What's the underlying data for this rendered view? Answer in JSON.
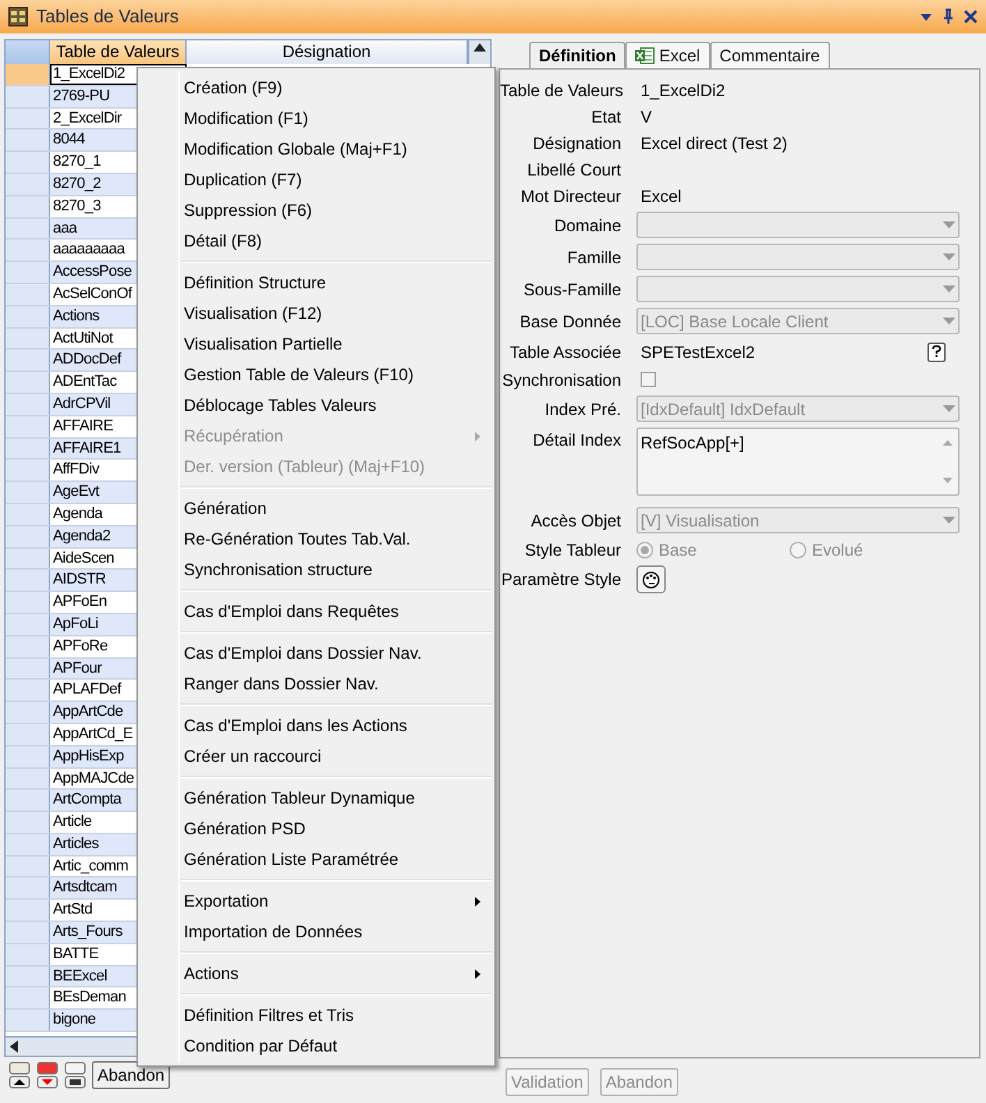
{
  "window": {
    "title": "Tables de Valeurs"
  },
  "grid": {
    "columns": [
      "Table de Valeurs",
      "Désignation"
    ],
    "rows": [
      {
        "value": "1_ExcelDi2",
        "selected": true
      },
      {
        "value": "2769-PU",
        "selected": false
      },
      {
        "value": "2_ExcelDir",
        "selected": false
      },
      {
        "value": "8044",
        "selected": false
      },
      {
        "value": "8270_1",
        "selected": false
      },
      {
        "value": "8270_2",
        "selected": false
      },
      {
        "value": "8270_3",
        "selected": false
      },
      {
        "value": "aaa",
        "selected": false
      },
      {
        "value": "aaaaaaaaa",
        "selected": false
      },
      {
        "value": "AccessPose",
        "selected": false
      },
      {
        "value": "AcSelConOf",
        "selected": false
      },
      {
        "value": "Actions",
        "selected": false
      },
      {
        "value": "ActUtiNot",
        "selected": false
      },
      {
        "value": "ADDocDef",
        "selected": false
      },
      {
        "value": "ADEntTac",
        "selected": false
      },
      {
        "value": "AdrCPVil",
        "selected": false
      },
      {
        "value": "AFFAIRE",
        "selected": false
      },
      {
        "value": "AFFAIRE1",
        "selected": false
      },
      {
        "value": "AffFDiv",
        "selected": false
      },
      {
        "value": "AgeEvt",
        "selected": false
      },
      {
        "value": "Agenda",
        "selected": false
      },
      {
        "value": "Agenda2",
        "selected": false
      },
      {
        "value": "AideScen",
        "selected": false
      },
      {
        "value": "AIDSTR",
        "selected": false
      },
      {
        "value": "APFoEn",
        "selected": false
      },
      {
        "value": "ApFoLi",
        "selected": false
      },
      {
        "value": "APFoRe",
        "selected": false
      },
      {
        "value": "APFour",
        "selected": false
      },
      {
        "value": "APLAFDef",
        "selected": false
      },
      {
        "value": "AppArtCde",
        "selected": false
      },
      {
        "value": "AppArtCd_E",
        "selected": false
      },
      {
        "value": "AppHisExp",
        "selected": false
      },
      {
        "value": "AppMAJCde",
        "selected": false
      },
      {
        "value": "ArtCompta",
        "selected": false
      },
      {
        "value": "Article",
        "selected": false
      },
      {
        "value": "Articles",
        "selected": false
      },
      {
        "value": "Artic_comm",
        "selected": false
      },
      {
        "value": "Artsdtcam",
        "selected": false
      },
      {
        "value": "ArtStd",
        "selected": false
      },
      {
        "value": "Arts_Fours",
        "selected": false
      },
      {
        "value": "BATTE",
        "selected": false
      },
      {
        "value": "BEExcel",
        "selected": false
      },
      {
        "value": "BEsDeman",
        "selected": false
      },
      {
        "value": "bigone",
        "selected": false
      }
    ]
  },
  "grid_footer": {
    "button": "Abandon"
  },
  "context_menu": {
    "groups": [
      [
        {
          "label": "Création (F9)",
          "disabled": false,
          "submenu": false
        },
        {
          "label": "Modification (F1)",
          "disabled": false,
          "submenu": false
        },
        {
          "label": "Modification Globale (Maj+F1)",
          "disabled": false,
          "submenu": false
        },
        {
          "label": "Duplication (F7)",
          "disabled": false,
          "submenu": false
        },
        {
          "label": "Suppression (F6)",
          "disabled": false,
          "submenu": false
        },
        {
          "label": "Détail (F8)",
          "disabled": false,
          "submenu": false
        }
      ],
      [
        {
          "label": "Définition Structure",
          "disabled": false,
          "submenu": false
        },
        {
          "label": "Visualisation (F12)",
          "disabled": false,
          "submenu": false
        },
        {
          "label": "Visualisation Partielle",
          "disabled": false,
          "submenu": false
        },
        {
          "label": "Gestion Table de Valeurs (F10)",
          "disabled": false,
          "submenu": false
        },
        {
          "label": "Déblocage Tables Valeurs",
          "disabled": false,
          "submenu": false
        },
        {
          "label": "Récupération",
          "disabled": true,
          "submenu": true
        },
        {
          "label": "Der. version (Tableur) (Maj+F10)",
          "disabled": true,
          "submenu": false
        }
      ],
      [
        {
          "label": "Génération",
          "disabled": false,
          "submenu": false
        },
        {
          "label": "Re-Génération Toutes Tab.Val.",
          "disabled": false,
          "submenu": false
        },
        {
          "label": "Synchronisation structure",
          "disabled": false,
          "submenu": false
        }
      ],
      [
        {
          "label": "Cas d'Emploi dans Requêtes",
          "disabled": false,
          "submenu": false
        }
      ],
      [
        {
          "label": "Cas d'Emploi dans Dossier Nav.",
          "disabled": false,
          "submenu": false
        },
        {
          "label": "Ranger dans Dossier Nav.",
          "disabled": false,
          "submenu": false
        }
      ],
      [
        {
          "label": "Cas d'Emploi dans les Actions",
          "disabled": false,
          "submenu": false
        },
        {
          "label": "Créer un raccourci",
          "disabled": false,
          "submenu": false
        }
      ],
      [
        {
          "label": "Génération Tableur Dynamique",
          "disabled": false,
          "submenu": false
        },
        {
          "label": "Génération PSD",
          "disabled": false,
          "submenu": false
        },
        {
          "label": "Génération Liste Paramétrée",
          "disabled": false,
          "submenu": false
        }
      ],
      [
        {
          "label": "Exportation",
          "disabled": false,
          "submenu": true
        },
        {
          "label": "Importation de Données",
          "disabled": false,
          "submenu": false
        }
      ],
      [
        {
          "label": "Actions",
          "disabled": false,
          "submenu": true
        }
      ],
      [
        {
          "label": "Définition Filtres et Tris",
          "disabled": false,
          "submenu": false
        },
        {
          "label": "Condition par Défaut",
          "disabled": false,
          "submenu": false
        }
      ]
    ]
  },
  "detail": {
    "tabs": [
      {
        "label": "Définition",
        "selected": true,
        "kind": "plain"
      },
      {
        "label": "Excel",
        "selected": false,
        "kind": "excel"
      },
      {
        "label": "Commentaire",
        "selected": false,
        "kind": "plain"
      }
    ],
    "fields": [
      {
        "kind": "text",
        "label": "Table de Valeurs",
        "value": "1_ExcelDi2"
      },
      {
        "kind": "text",
        "label": "Etat",
        "value": "V"
      },
      {
        "kind": "text",
        "label": "Désignation",
        "value": "Excel direct (Test 2)"
      },
      {
        "kind": "text",
        "label": "Libellé Court"
      },
      {
        "kind": "text",
        "label": "Mot Directeur",
        "value": "Excel"
      },
      {
        "kind": "combo",
        "label": "Domaine",
        "disabled": true
      },
      {
        "kind": "combo",
        "label": "Famille",
        "disabled": true
      },
      {
        "kind": "combo",
        "label": "Sous-Famille",
        "disabled": true
      },
      {
        "kind": "combo",
        "label": "Base Donnée",
        "value": "[LOC] Base Locale Client",
        "disabled": true
      },
      {
        "kind": "text_help",
        "label": "Table Associée",
        "value": "SPETestExcel2"
      },
      {
        "kind": "checkbox",
        "label": "Synchronisation",
        "checked": false
      },
      {
        "kind": "combo",
        "label": "Index Pré.",
        "value": "[IdxDefault] IdxDefault",
        "disabled": true
      },
      {
        "kind": "textarea",
        "label": "Détail Index",
        "value": "RefSocApp[+]"
      },
      {
        "kind": "combo",
        "label": "Accès Objet",
        "value": "[V] Visualisation",
        "disabled": true
      },
      {
        "kind": "radio",
        "label": "Style Tableur",
        "options": [
          {
            "label": "Base",
            "selected": true
          },
          {
            "label": "Evolué",
            "selected": false
          }
        ]
      },
      {
        "kind": "style_button",
        "label": "Paramètre Style"
      }
    ]
  },
  "footer_buttons": [
    {
      "label": "Validation",
      "disabled": true
    },
    {
      "label": "Abandon",
      "disabled": true
    }
  ]
}
